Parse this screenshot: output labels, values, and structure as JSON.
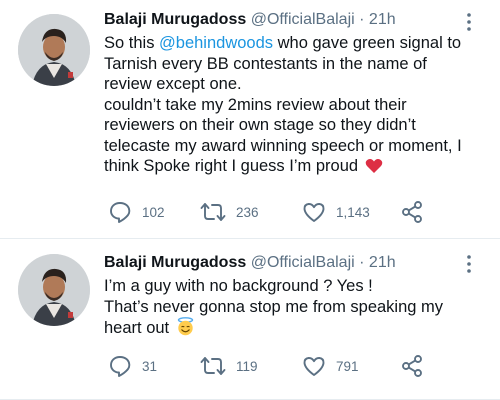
{
  "tweets": [
    {
      "author_name": "Balaji Murugadoss",
      "handle": "@OfficialBalaji",
      "separator": "·",
      "time": "21h",
      "lines": [
        {
          "mention": "@behindwoods",
          "text": " who gave green signal to",
          "prefix": "So this "
        },
        {
          "prefix": "Tarnish every BB contestants in the name of"
        },
        {
          "prefix": "review except one."
        },
        {
          "prefix": "couldn’t take my 2mins review about their"
        },
        {
          "prefix": "reviewers on their own stage so they didn’t"
        },
        {
          "prefix": "telecaste my award winning speech or moment, I"
        },
        {
          "prefix": "think Spoke right I guess I’m proud"
        }
      ],
      "trailing_emoji": "red-heart-emoji",
      "replies": "102",
      "retweets": "236",
      "likes": "1,143"
    },
    {
      "author_name": "Balaji Murugadoss",
      "handle": "@OfficialBalaji",
      "separator": "·",
      "time": "21h",
      "lines": [
        {
          "prefix": "I’m a guy with no background ? Yes !"
        },
        {
          "prefix": "That’s  never gonna stop me from speaking my"
        },
        {
          "prefix": "heart out"
        }
      ],
      "trailing_emoji": "smiling-face-with-halo-emoji",
      "replies": "31",
      "retweets": "119",
      "likes": "791"
    }
  ],
  "icons": {
    "reply": "reply-icon",
    "retweet": "retweet-icon",
    "like": "like-icon",
    "share": "share-icon",
    "more": "more-icon"
  },
  "colors": {
    "text": "#0f1419",
    "secondary": "#5b7083",
    "link": "#1b95e0",
    "heart": "#e0245e",
    "divider": "#e6ecf0"
  }
}
